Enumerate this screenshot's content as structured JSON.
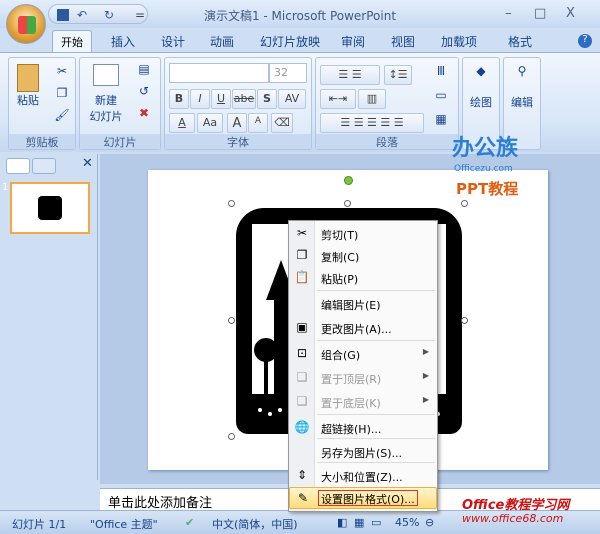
{
  "window": {
    "title": "演示文稿1 - Microsoft PowerPoint",
    "minimize": "–",
    "maximize": "□",
    "close": "X"
  },
  "qat": {
    "save": "save-icon",
    "undo": "↶",
    "redo": "↻",
    "more": "="
  },
  "tabs": [
    "开始",
    "插入",
    "设计",
    "动画",
    "幻灯片放映",
    "审阅",
    "视图",
    "加载项",
    "格式"
  ],
  "help": "?",
  "ribbon": {
    "clipboard": {
      "label": "剪贴板",
      "paste": "粘贴"
    },
    "slides": {
      "label": "幻灯片",
      "new_slide": "新建",
      "new_slide2": "幻灯片"
    },
    "font": {
      "label": "字体",
      "font_name": "",
      "font_size": "32",
      "bold": "B",
      "italic": "I",
      "underline": "U",
      "strike": "abe",
      "shadow": "S",
      "spacing": "AV",
      "color": "A",
      "case": "Aa",
      "grow": "A",
      "shrink": "A"
    },
    "paragraph": {
      "label": "段落"
    },
    "drawing": {
      "label": "绘图"
    },
    "editing": {
      "label": "编辑"
    }
  },
  "watermark": {
    "brand": "办公族",
    "sub": "PPT教程",
    "site": "Officezu.com",
    "footer1": "Office教程学习网",
    "footer2": "www.office68.com"
  },
  "leftpane": {
    "slide_number": "1"
  },
  "notes": {
    "placeholder": "单击此处添加备注"
  },
  "context_menu": [
    {
      "label": "剪切(T)",
      "icon": "scissors-icon",
      "glyph": "✂"
    },
    {
      "label": "复制(C)",
      "icon": "copy-icon",
      "glyph": "❐"
    },
    {
      "label": "粘贴(P)",
      "icon": "paste-icon",
      "glyph": "📋"
    },
    {
      "label": "编辑图片(E)",
      "icon": "",
      "glyph": ""
    },
    {
      "label": "更改图片(A)...",
      "icon": "change-picture-icon",
      "glyph": "▣"
    },
    {
      "label": "组合(G)",
      "icon": "group-icon",
      "glyph": "⊡",
      "submenu": true
    },
    {
      "label": "置于顶层(R)",
      "icon": "bring-front-icon",
      "glyph": "❏",
      "submenu": true,
      "disabled": true
    },
    {
      "label": "置于底层(K)",
      "icon": "send-back-icon",
      "glyph": "❏",
      "submenu": true,
      "disabled": true
    },
    {
      "label": "超链接(H)...",
      "icon": "hyperlink-icon",
      "glyph": "🌐"
    },
    {
      "label": "另存为图片(S)...",
      "icon": "",
      "glyph": ""
    },
    {
      "label": "大小和位置(Z)...",
      "icon": "size-position-icon",
      "glyph": "⇕"
    },
    {
      "label": "设置图片格式(O)...",
      "icon": "format-picture-icon",
      "glyph": "✎",
      "highlighted": true
    }
  ],
  "status": {
    "slide": "幻灯片 1/1",
    "theme": "\"Office 主题\"",
    "language": "中文(简体，中国)",
    "zoom": "45%"
  }
}
